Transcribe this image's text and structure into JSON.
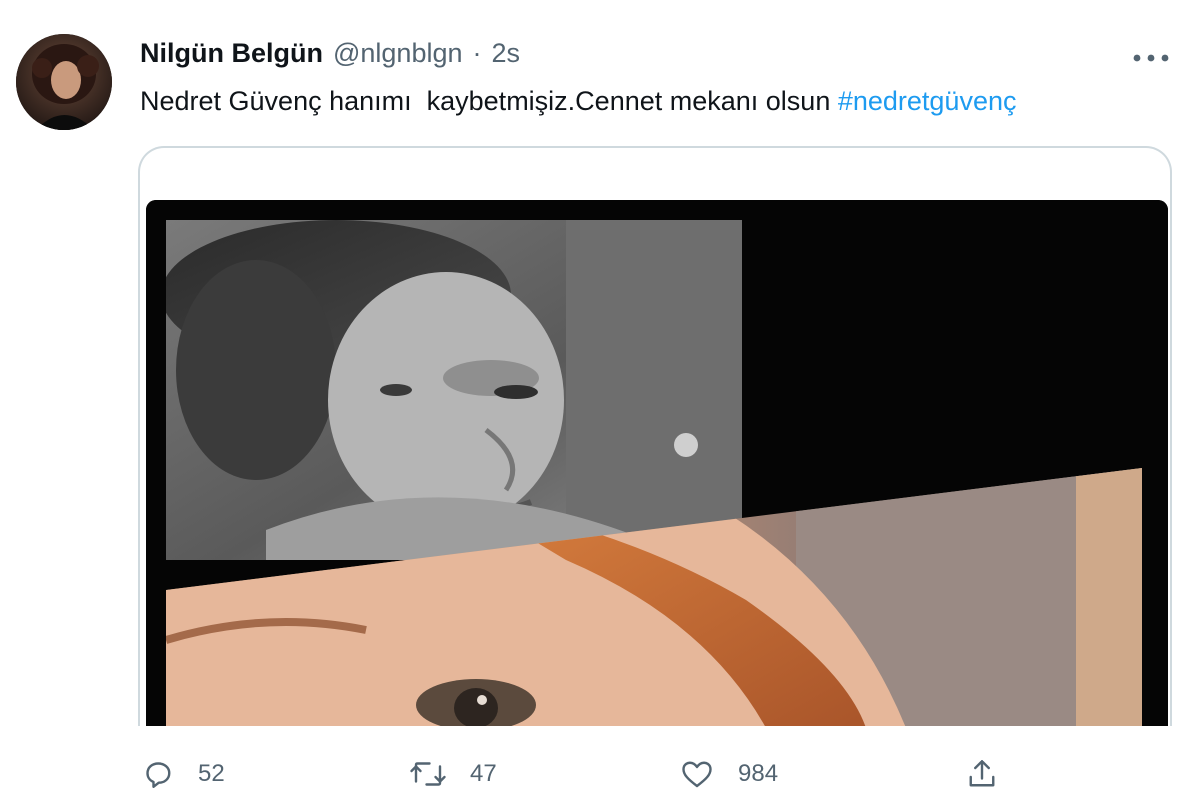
{
  "tweet": {
    "display_name": "Nilgün Belgün",
    "handle": "@nlgnblgn",
    "separator": "·",
    "time": "2s",
    "text": "Nedret Güvenç hanımı  kaybetmişiz.Cennet mekanı olsun ",
    "hashtag": "#nedretgüvenç"
  },
  "actions": {
    "reply_count": "52",
    "retweet_count": "47",
    "like_count": "984"
  },
  "icons": {
    "more": "more-horizontal-icon",
    "reply": "reply-icon",
    "retweet": "retweet-icon",
    "like": "like-icon",
    "share": "share-icon"
  },
  "colors": {
    "text": "#0f1419",
    "secondary": "#536471",
    "link": "#1d9bf0",
    "border": "#cfd9de"
  }
}
